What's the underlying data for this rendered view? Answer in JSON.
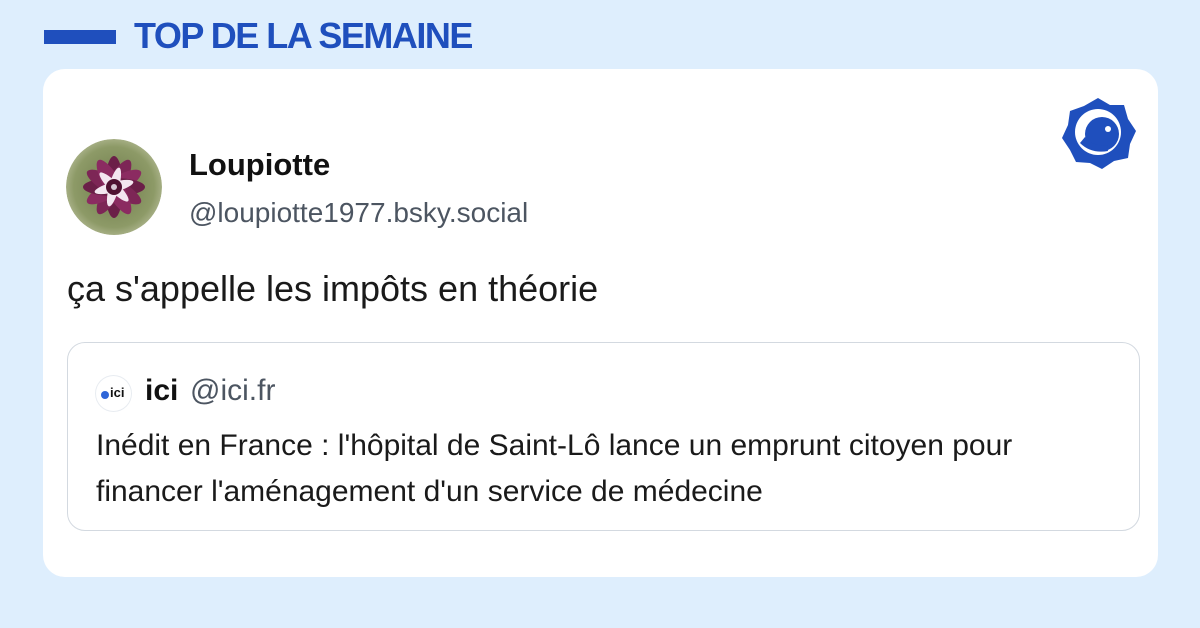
{
  "section": {
    "title": "TOP DE LA SEMAINE",
    "accent_color": "#1f4fbd",
    "background_color": "#deeefd"
  },
  "post": {
    "display_name": "Loupiotte",
    "handle": "@loupiotte1977.bsky.social",
    "avatar_icon": "dahlia-flower-photo",
    "text": "ça s'appelle les impôts en théorie",
    "platform_icon": "bluesky-butterfly-badge-icon"
  },
  "quote": {
    "avatar_label": "ici",
    "display_name": "ici",
    "handle": "@ici.fr",
    "text": "Inédit en France : l'hôpital de Saint-Lô lance un emprunt citoyen pour financer l'aménagement d'un service de médecine"
  }
}
